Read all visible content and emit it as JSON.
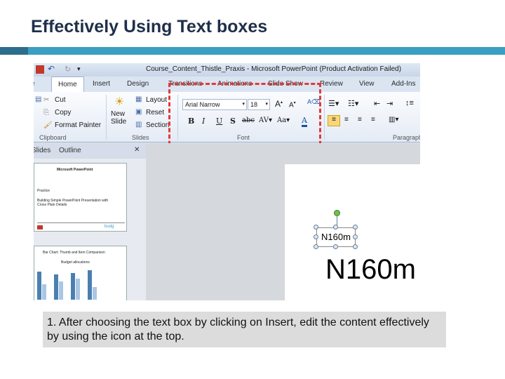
{
  "slide": {
    "title": "Effectively Using Text boxes",
    "caption": "1. After choosing the text box by clicking on Insert, edit the content effectively by using the icon at the top."
  },
  "window": {
    "title": "Course_Content_Thistle_Praxis - Microsoft PowerPoint (Product Activation Failed)"
  },
  "ribbon_tabs": [
    "Home",
    "Insert",
    "Design",
    "Transitions",
    "Animations",
    "Slide Show",
    "Review",
    "View",
    "Add-Ins"
  ],
  "clipboard": {
    "cut": "Cut",
    "copy": "Copy",
    "format_painter": "Format Painter",
    "group": "Clipboard"
  },
  "slides_group": {
    "new_slide": "New Slide",
    "layout": "Layout",
    "reset": "Reset",
    "section": "Section",
    "group": "Slides"
  },
  "font_group": {
    "font_name": "Arial Narrow",
    "font_size": "18",
    "group": "Font"
  },
  "paragraph_group": {
    "group": "Paragraph"
  },
  "pane_tabs": [
    "Slides",
    "Outline"
  ],
  "thumb1": {
    "heading": "Microsoft PowerPoint",
    "line1": "Practice",
    "line2": "Building Simple PowerPoint Presentation with Cross Plain Details"
  },
  "thumb2": {
    "heading": "Bar Chart: Thumb and Item Comparison",
    "chart_title": "Budget allocations"
  },
  "textbox_small": "N160m",
  "textbox_large": "N160m",
  "colors": {
    "accent": "#3a9fc2",
    "highlight_dash": "#e03a3a"
  }
}
